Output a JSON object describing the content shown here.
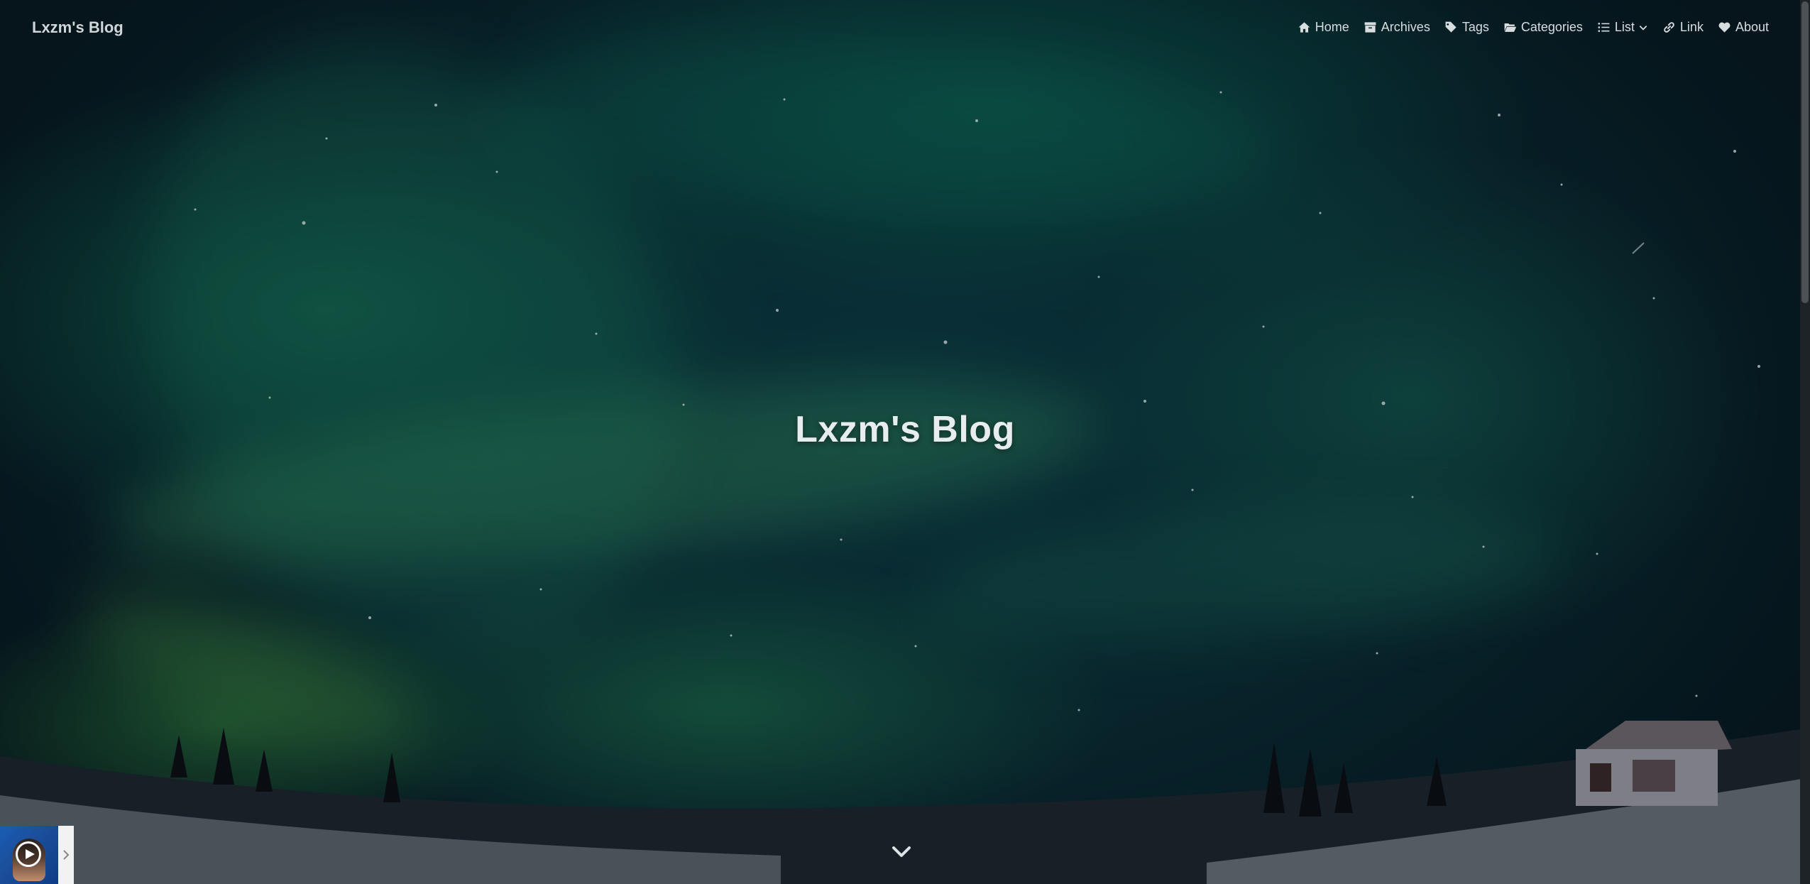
{
  "header": {
    "brand": "Lxzm's Blog"
  },
  "nav": {
    "items": [
      {
        "label": "Home",
        "icon": "home-icon"
      },
      {
        "label": "Archives",
        "icon": "archive-icon"
      },
      {
        "label": "Tags",
        "icon": "tags-icon"
      },
      {
        "label": "Categories",
        "icon": "folder-open-icon"
      },
      {
        "label": "List",
        "icon": "list-icon",
        "dropdown": true
      },
      {
        "label": "Link",
        "icon": "link-icon"
      },
      {
        "label": "About",
        "icon": "heart-icon"
      }
    ]
  },
  "hero": {
    "title": "Lxzm's Blog",
    "background": "aurora night sky over snowy forest"
  },
  "player": {
    "state": "paused"
  },
  "colors": {
    "nav_text": "#d8dde0",
    "title_text": "#e7ecee",
    "sky_dark": "#071a22",
    "aurora_green": "#1f8a66"
  }
}
